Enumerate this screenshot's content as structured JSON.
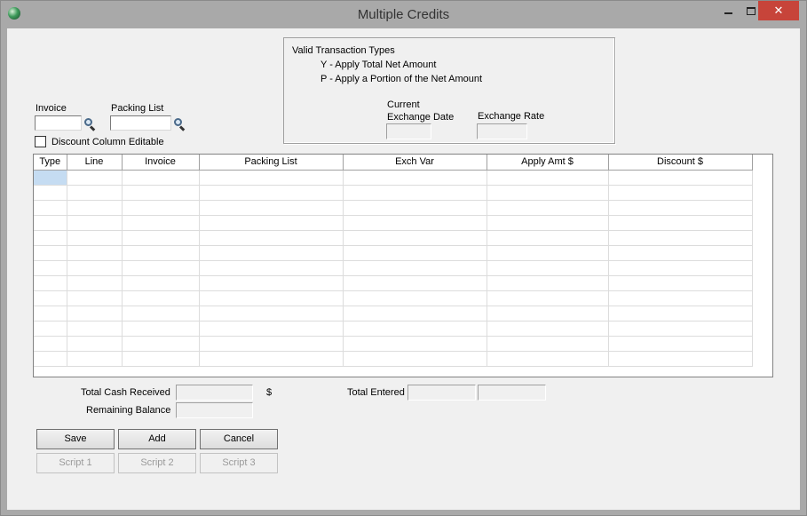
{
  "window": {
    "title": "Multiple Credits",
    "close_glyph": "✕"
  },
  "transaction_types": {
    "heading": "Valid Transaction Types",
    "line_y": "Y - Apply Total Net Amount",
    "line_p": "P - Apply a Portion of the Net Amount",
    "current_label": "Current",
    "exchange_date_label": "Exchange Date",
    "exchange_rate_label": "Exchange Rate",
    "exchange_date_value": "",
    "exchange_rate_value": ""
  },
  "filters": {
    "invoice_label": "Invoice",
    "invoice_value": "",
    "packing_list_label": "Packing List",
    "packing_list_value": "",
    "discount_checkbox_label": "Discount Column Editable",
    "discount_checked": false
  },
  "grid": {
    "columns": [
      "Type",
      "Line",
      "Invoice",
      "Packing List",
      "Exch Var",
      "Apply Amt $",
      "Discount $"
    ],
    "row_count": 13
  },
  "totals": {
    "total_cash_received_label": "Total Cash Received",
    "total_cash_received_value": "",
    "currency_symbol": "$",
    "remaining_balance_label": "Remaining Balance",
    "remaining_balance_value": "",
    "total_entered_label": "Total Entered",
    "total_entered_value_1": "",
    "total_entered_value_2": ""
  },
  "buttons": {
    "save": "Save",
    "add": "Add",
    "cancel": "Cancel",
    "script1": "Script 1",
    "script2": "Script 2",
    "script3": "Script 3"
  }
}
